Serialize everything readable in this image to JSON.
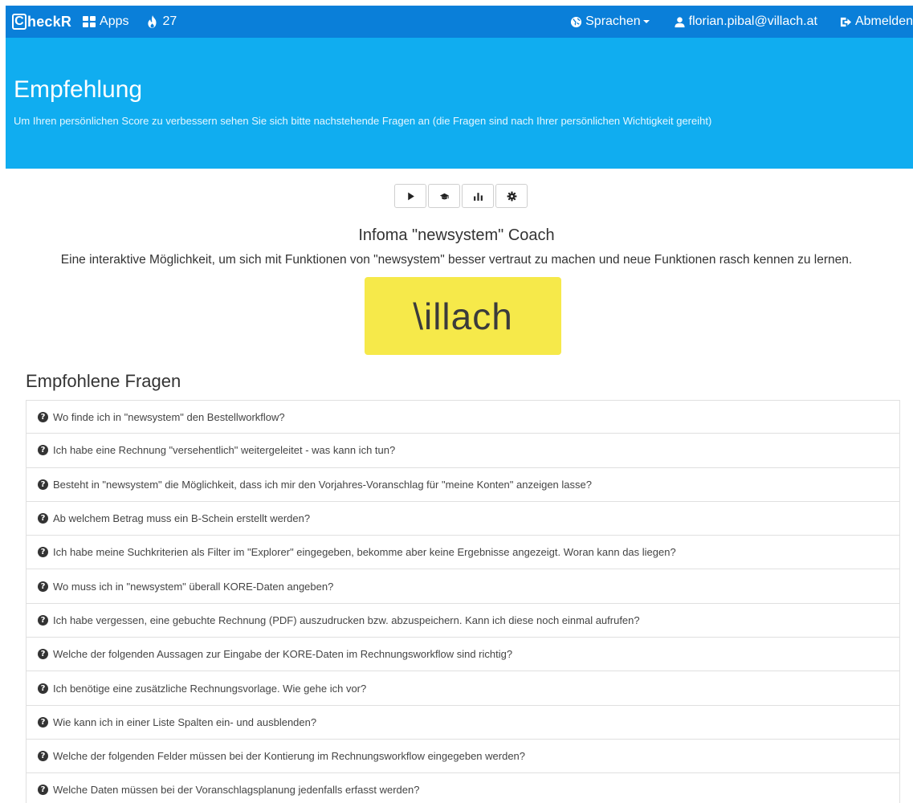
{
  "navbar": {
    "brand_initial": "C",
    "brand_rest": "heckR",
    "apps_label": "Apps",
    "streak_count": "27",
    "language_label": "Sprachen",
    "user_email": "florian.pibal@villach.at",
    "logout_label": "Abmelden"
  },
  "jumbotron": {
    "title": "Empfehlung",
    "subtitle": "Um Ihren persönlichen Score zu verbessern sehen Sie sich bitte nachstehende Fragen an (die Fragen sind nach Ihrer persönlichen Wichtigkeit gereiht)"
  },
  "toolbar": {
    "buttons": [
      {
        "icon": "play-icon"
      },
      {
        "icon": "graduation-cap-icon"
      },
      {
        "icon": "bar-chart-icon"
      },
      {
        "icon": "gear-icon"
      }
    ]
  },
  "coach": {
    "title": "Infoma \"newsystem\" Coach",
    "description": "Eine interaktive Möglichkeit, um sich mit Funktionen von \"newsystem\" besser vertraut zu machen und neue Funktionen rasch kennen zu lernen.",
    "logo_text": "\\illach",
    "logo_color": "#f6e94a"
  },
  "recommended": {
    "title": "Empfohlene Fragen",
    "questions": [
      "Wo finde ich in \"newsystem\" den Bestellworkflow?",
      "Ich habe eine Rechnung \"versehentlich\" weitergeleitet - was kann ich tun?",
      "Besteht in \"newsystem\" die Möglichkeit, dass ich mir den Vorjahres-Voranschlag für \"meine Konten\" anzeigen lasse?",
      "Ab welchem Betrag muss ein B-Schein erstellt werden?",
      "Ich habe meine Suchkriterien als Filter im \"Explorer\" eingegeben, bekomme aber keine Ergebnisse angezeigt. Woran kann das liegen?",
      "Wo muss ich in \"newsystem\" überall KORE-Daten angeben?",
      "Ich habe vergessen, eine gebuchte Rechnung (PDF) auszudrucken bzw. abzuspeichern. Kann ich diese noch einmal aufrufen?",
      "Welche der folgenden Aussagen zur Eingabe der KORE-Daten im Rechnungsworkflow sind richtig?",
      "Ich benötige eine zusätzliche Rechnungsvorlage. Wie gehe ich vor?",
      "Wie kann ich in einer Liste Spalten ein- und ausblenden?",
      "Welche der folgenden Felder müssen bei der Kontierung im Rechnungsworkflow eingegeben werden?",
      "Welche Daten müssen bei der Voranschlagsplanung jedenfalls erfasst werden?"
    ]
  },
  "colors": {
    "navbar": "#0a7fd9",
    "jumbotron": "#10adf0"
  }
}
